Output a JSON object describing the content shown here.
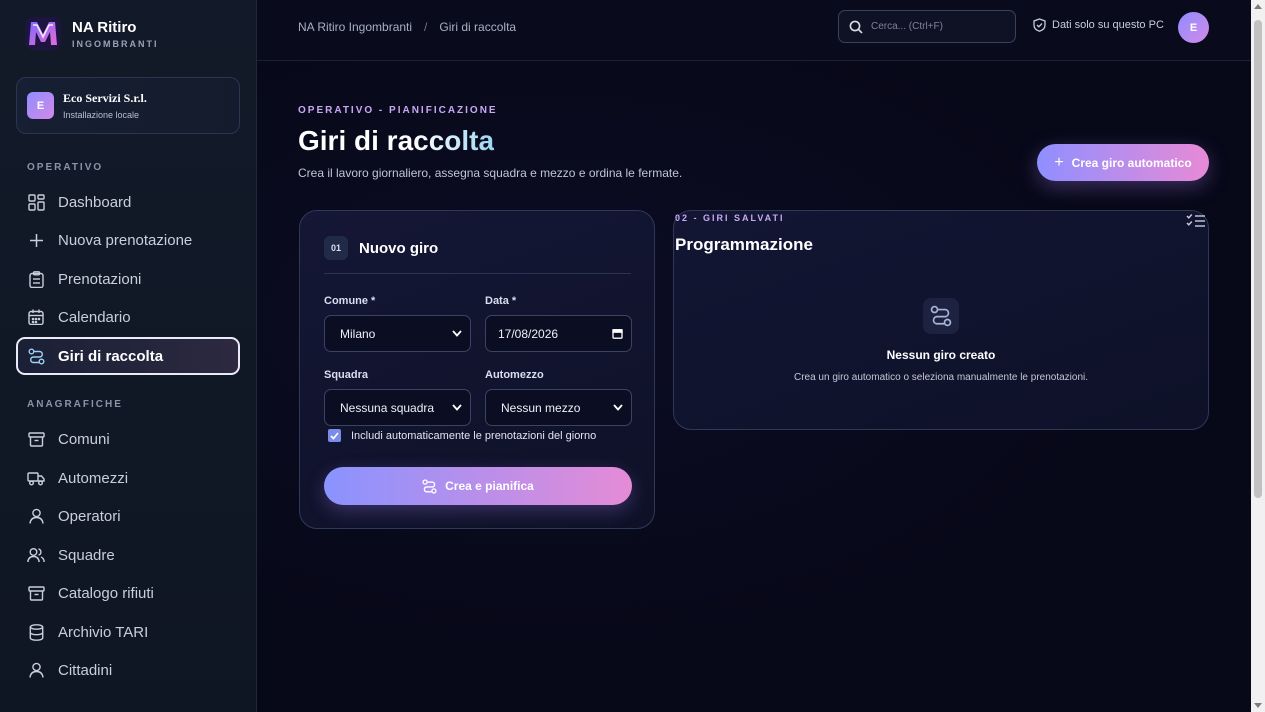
{
  "brand": {
    "name": "NA Ritiro",
    "subtitle": "INGOMBRANTI"
  },
  "org": {
    "initial": "E",
    "name": "Eco Servizi S.r.l.",
    "subtitle": "Installazione locale"
  },
  "sidebar": {
    "section_operativo": "OPERATIVO",
    "section_anagrafiche": "ANAGRAFICHE",
    "operativo_items": [
      {
        "label": "Dashboard",
        "icon": "dashboard-icon"
      },
      {
        "label": "Nuova prenotazione",
        "icon": "plus-icon"
      },
      {
        "label": "Prenotazioni",
        "icon": "clipboard-icon"
      },
      {
        "label": "Calendario",
        "icon": "calendar-icon"
      },
      {
        "label": "Giri di raccolta",
        "icon": "route-icon",
        "active": true
      }
    ],
    "anagrafiche_items": [
      {
        "label": "Comuni",
        "icon": "archive-icon"
      },
      {
        "label": "Automezzi",
        "icon": "truck-icon"
      },
      {
        "label": "Operatori",
        "icon": "user-icon"
      },
      {
        "label": "Squadre",
        "icon": "users-icon"
      },
      {
        "label": "Catalogo rifiuti",
        "icon": "archive-icon"
      },
      {
        "label": "Archivio TARI",
        "icon": "database-icon"
      },
      {
        "label": "Cittadini",
        "icon": "user-icon"
      }
    ]
  },
  "header": {
    "breadcrumb": [
      "NA Ritiro Ingombranti",
      "Giri di raccolta"
    ],
    "breadcrumb_sep": "/",
    "search_placeholder": "Cerca... (Ctrl+F)",
    "local_data_label": "Dati solo su questo PC",
    "user_initial": "E"
  },
  "page": {
    "eyebrow": "OPERATIVO - PIANIFICAZIONE",
    "title": "Giri di raccolta",
    "subtitle": "Crea il lavoro giornaliero, assegna squadra e mezzo e ordina le fermate.",
    "auto_button": "Crea giro automatico"
  },
  "new_route": {
    "number": "01",
    "title": "Nuovo giro",
    "comune_label": "Comune *",
    "comune_value": "Milano",
    "data_label": "Data *",
    "data_value": "17/08/2026",
    "squadra_label": "Squadra",
    "squadra_value": "Nessuna squadra",
    "automezzo_label": "Automezzo",
    "automezzo_value": "Nessun mezzo",
    "include_label": "Includi automaticamente le prenotazioni del giorno",
    "include_checked": true,
    "create_button": "Crea e pianifica"
  },
  "saved_routes": {
    "eyebrow": "02 - GIRI SALVATI",
    "title": "Programmazione",
    "empty_title": "Nessun giro creato",
    "empty_subtitle": "Crea un giro automatico o seleziona manualmente le prenotazioni."
  },
  "colors": {
    "accent_start": "#8f8fff",
    "accent_end": "#e88ad6",
    "eyebrow": "#c9a8f3",
    "background": "#070818",
    "sidebar": "#121a29"
  }
}
